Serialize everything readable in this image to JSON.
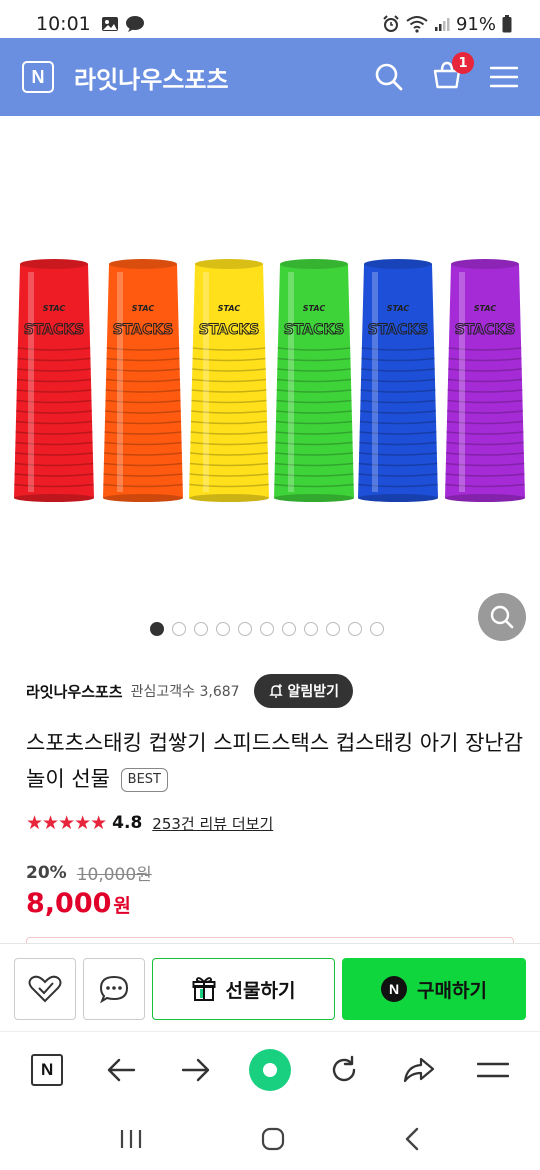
{
  "status_bar": {
    "time": "10:01",
    "battery": "91%"
  },
  "header": {
    "logo_letter": "N",
    "title": "라잇나우스포츠",
    "cart_count": "1"
  },
  "product_image": {
    "cup_colors": [
      "#ee1c24",
      "#ff5a10",
      "#ffe01a",
      "#3fd33a",
      "#1d4fd8",
      "#a52bd6"
    ],
    "cup_label": "STACKS",
    "brand_mark": "STAC"
  },
  "carousel": {
    "total": 11,
    "active_index": 0
  },
  "store": {
    "name": "라잇나우스포츠",
    "followers": "관심고객수 3,687",
    "alarm_label": "알림받기"
  },
  "product": {
    "title": "스포츠스태킹 컵쌓기 스피드스택스 컵스태킹 아기 장난감 놀이 선물",
    "badge": "BEST",
    "stars": "★★★★★",
    "rating": "4.8",
    "review_link": "253건 리뷰 더보기"
  },
  "price": {
    "discount": "20%",
    "original": "10,000원",
    "final": "8,000",
    "currency": "원"
  },
  "actions": {
    "gift_label": "선물하기",
    "buy_label": "구매하기",
    "buy_logo": "N"
  },
  "browser_bar": {
    "logo_letter": "N"
  },
  "colors": {
    "header_bg": "#6b8fe0",
    "price_red": "#e0002a",
    "buy_green": "#0fd63c",
    "star_red": "#e8263b",
    "home_green": "#19cf80"
  }
}
